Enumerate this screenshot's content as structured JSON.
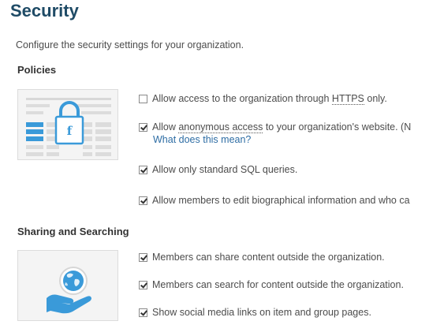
{
  "page": {
    "title": "Security",
    "intro": "Configure the security settings for your organization."
  },
  "policies": {
    "heading": "Policies",
    "options": [
      {
        "pre": "Allow access to the organization through ",
        "term": "HTTPS",
        "post": " only.",
        "checked": false
      },
      {
        "pre": "Allow ",
        "term": "anonymous access",
        "post": " to your organization's website. (N",
        "checked": true
      },
      {
        "label": "Allow only standard SQL queries.",
        "checked": true
      },
      {
        "label": "Allow members to edit biographical information and who ca",
        "checked": true
      }
    ],
    "help_link": "What does this mean?"
  },
  "sharing": {
    "heading": "Sharing and Searching",
    "options": [
      {
        "label": "Members can share content outside the organization.",
        "checked": true
      },
      {
        "label": "Members can search for content outside the organization.",
        "checked": true
      },
      {
        "label": "Show social media links on item and group pages.",
        "checked": true
      }
    ]
  },
  "illustrations": {
    "policies_icon": "lock-document-icon",
    "sharing_icon": "globe-in-hand-icon",
    "accent_color": "#3a9ad9"
  }
}
